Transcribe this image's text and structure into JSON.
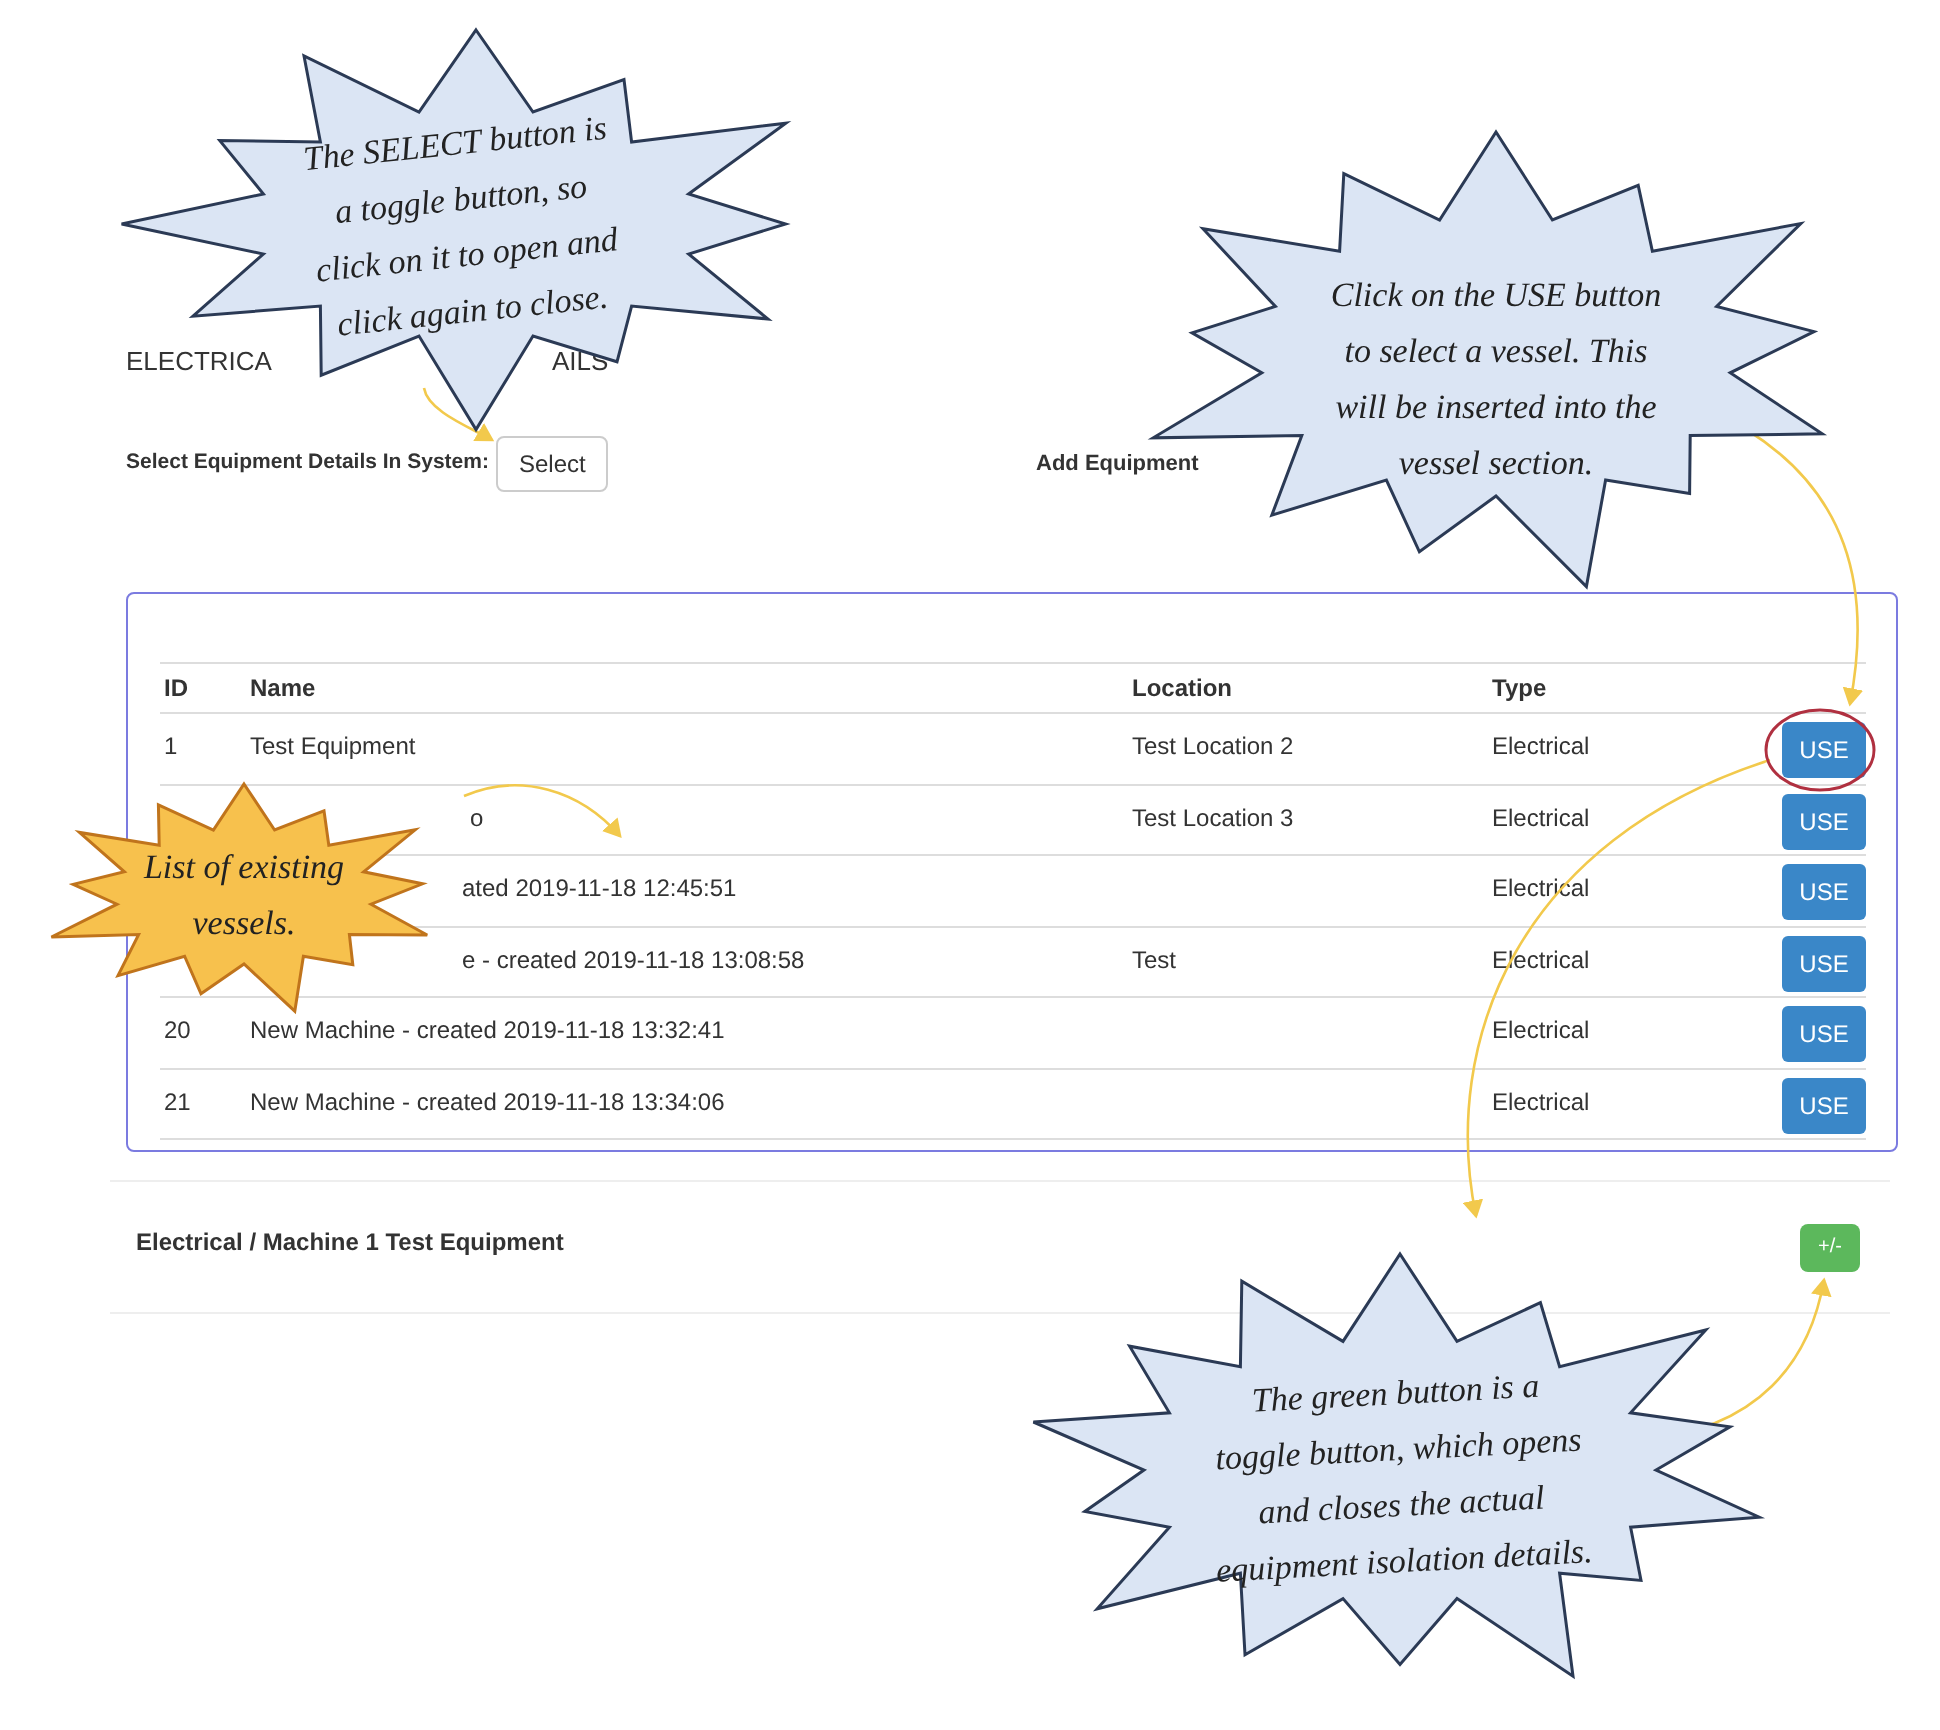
{
  "heading_parts": [
    "ELECTRICA",
    "AILS"
  ],
  "select_label": "Select Equipment Details In System:",
  "select_button": "Select",
  "add_label": "Add Equipment",
  "table": {
    "columns": [
      "ID",
      "Name",
      "Location",
      "Type"
    ],
    "rows": [
      {
        "id": "1",
        "name": "Test Equipment",
        "location": "Test Location 2",
        "type": "Electrical",
        "button": "USE",
        "highlighted": true
      },
      {
        "name": "o",
        "location": "Test Location 3",
        "type": "Electrical",
        "button": "USE",
        "highlighted": false
      },
      {
        "name": "ated 2019-11-18 12:45:51",
        "type": "Electrical",
        "button": "USE",
        "highlighted": false
      },
      {
        "name": "e - created 2019-11-18 13:08:58",
        "location": "Test",
        "type": "Electrical",
        "button": "USE",
        "highlighted": false
      },
      {
        "id": "20",
        "name": "New Machine - created 2019-11-18 13:32:41",
        "type": "Electrical",
        "button": "USE",
        "highlighted": false
      },
      {
        "id": "21",
        "name": "New Machine - created 2019-11-18 13:34:06",
        "type": "Electrical",
        "button": "USE",
        "highlighted": false
      }
    ]
  },
  "section": {
    "title": "Electrical / Machine 1 Test Equipment",
    "button": "+/-"
  },
  "callouts": [
    {
      "kind": "note",
      "lines": [
        "The SELECT button is",
        "a toggle button, so",
        "click on it to open and",
        "click again to close."
      ]
    },
    {
      "kind": "note",
      "lines": [
        "Click on the USE button",
        "to select a vessel. This",
        "will be inserted into the",
        "vessel section."
      ]
    },
    {
      "kind": "highlight",
      "lines": [
        "List of existing",
        "vessels."
      ]
    },
    {
      "kind": "note",
      "lines": [
        "The green button is a",
        "toggle button, which opens",
        "and closes the actual",
        "equipment isolation details."
      ]
    }
  ]
}
